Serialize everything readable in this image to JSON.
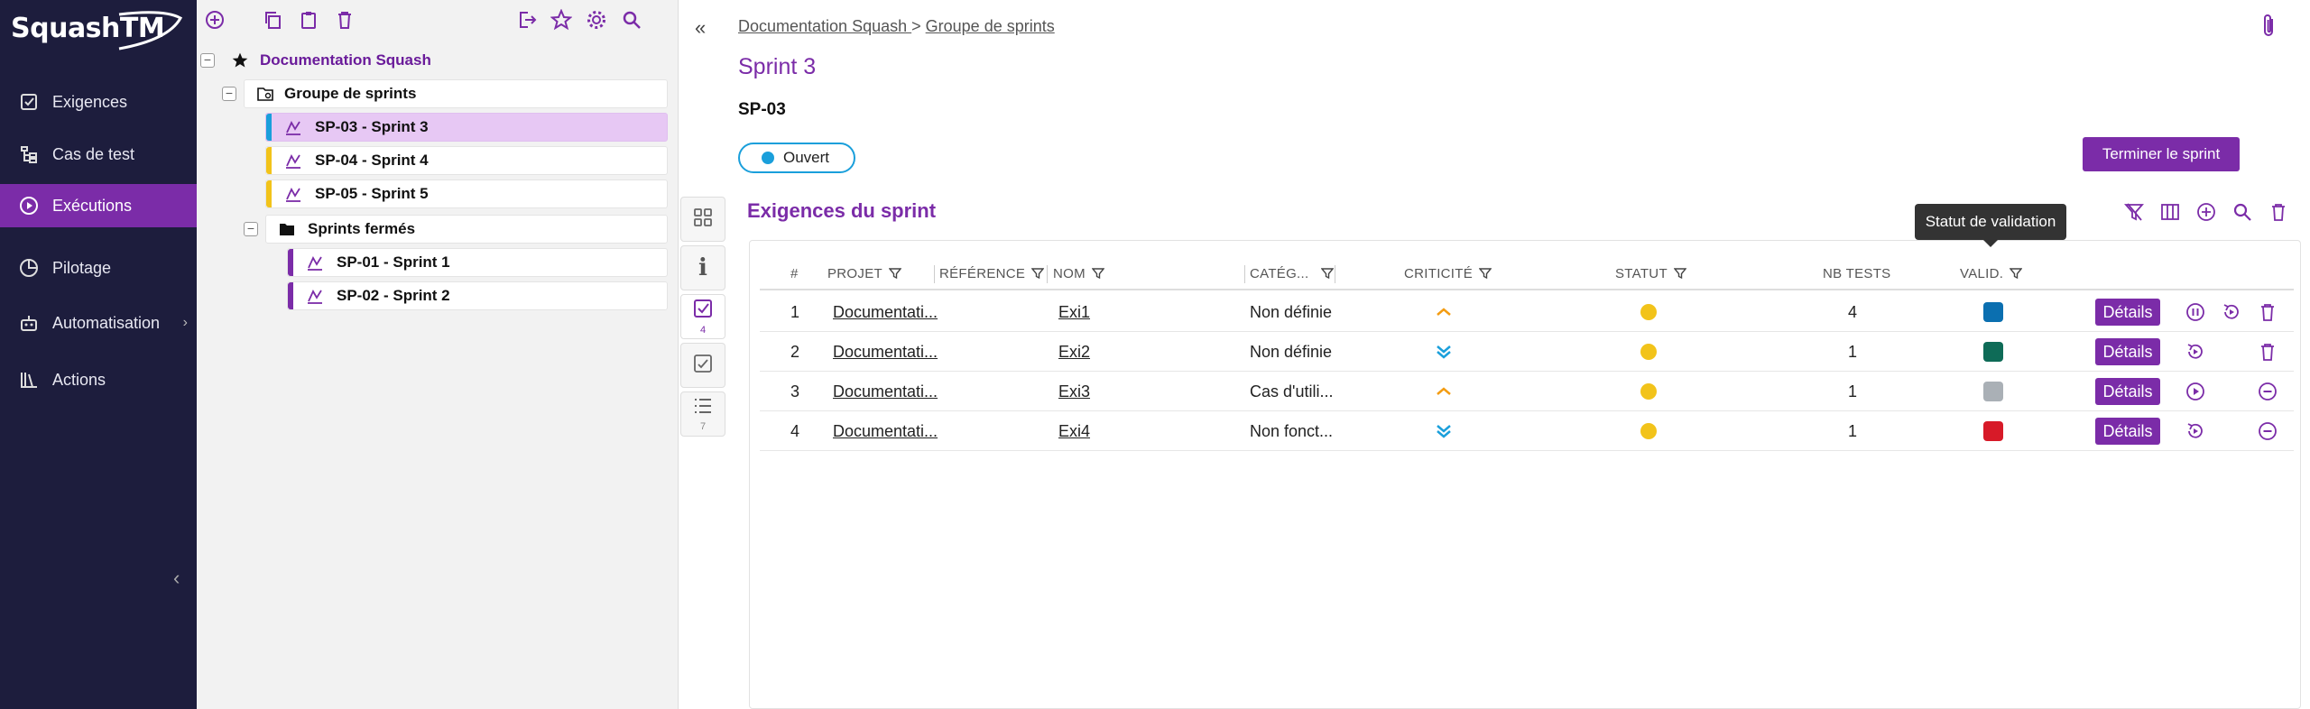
{
  "app": {
    "name": "SquashTM"
  },
  "nav": {
    "items": [
      {
        "label": "Exigences",
        "icon": "checkbox-icon",
        "active": false
      },
      {
        "label": "Cas de test",
        "icon": "tree-icon",
        "active": false
      },
      {
        "label": "Exécutions",
        "icon": "play-circle-icon",
        "active": true
      },
      {
        "label": "Pilotage",
        "icon": "pie-chart-icon",
        "active": false
      },
      {
        "label": "Automatisation",
        "icon": "robot-icon",
        "active": false
      },
      {
        "label": "Actions",
        "icon": "library-icon",
        "active": false
      }
    ],
    "collapse_glyph": "‹"
  },
  "tree": {
    "root": "Documentation Squash",
    "folder": "Groupe de sprints",
    "sprints": [
      {
        "label": "SP-03 - Sprint 3",
        "color": "#1a9fdb",
        "selected": true
      },
      {
        "label": "SP-04 - Sprint 4",
        "color": "#f2c31a",
        "selected": false
      },
      {
        "label": "SP-05 - Sprint 5",
        "color": "#f2c31a",
        "selected": false
      }
    ],
    "closed_folder": "Sprints fermés",
    "closed_sprints": [
      {
        "label": "SP-01 - Sprint 1",
        "color": "#7b2ca8"
      },
      {
        "label": "SP-02 - Sprint 2",
        "color": "#7b2ca8"
      }
    ]
  },
  "side_tabs": [
    {
      "icon": "dashboard-icon",
      "count": ""
    },
    {
      "icon": "info-icon",
      "count": ""
    },
    {
      "icon": "requirement-icon",
      "count": "4"
    },
    {
      "icon": "checklist-icon",
      "count": ""
    },
    {
      "icon": "list-icon",
      "count": "7"
    }
  ],
  "breadcrumb": {
    "part1": "Documentation Squash ",
    "sep": ">",
    "part2": "Groupe de sprints"
  },
  "header": {
    "title": "Sprint 3",
    "reference": "SP-03",
    "status": "Ouvert",
    "action_button": "Terminer le sprint"
  },
  "section": {
    "title": "Exigences du sprint",
    "tooltip": "Statut de validation"
  },
  "table": {
    "headers": {
      "num": "#",
      "project": "PROJET",
      "reference": "RÉFÉRENCE",
      "name": "NOM",
      "category": "CATÉG...",
      "criticality": "CRITICITÉ",
      "status": "STATUT",
      "nb_tests": "NB TESTS",
      "validation": "VALID."
    },
    "rows": [
      {
        "num": "1",
        "project": "Documentati...",
        "name": "Exi1",
        "category": "Non définie",
        "criticality": "major",
        "nb_tests": "4",
        "validation_color": "#0b6fb0",
        "details": "Détails",
        "actions": [
          "pause",
          "restart",
          "delete"
        ]
      },
      {
        "num": "2",
        "project": "Documentati...",
        "name": "Exi2",
        "category": "Non définie",
        "criticality": "minor",
        "nb_tests": "1",
        "validation_color": "#0e6b57",
        "details": "Détails",
        "actions": [
          "restart",
          "delete"
        ]
      },
      {
        "num": "3",
        "project": "Documentati...",
        "name": "Exi3",
        "category": "Cas d'utili...",
        "criticality": "major",
        "nb_tests": "1",
        "validation_color": "#aab0b6",
        "details": "Détails",
        "actions": [
          "play",
          "remove"
        ]
      },
      {
        "num": "4",
        "project": "Documentati...",
        "name": "Exi4",
        "category": "Non fonct...",
        "criticality": "minor",
        "nb_tests": "1",
        "validation_color": "#d71a28",
        "details": "Détails",
        "actions": [
          "restart",
          "remove"
        ]
      }
    ]
  },
  "colors": {
    "accent": "#7b2ca8",
    "nav_bg": "#1d1d3d",
    "status_open": "#1a9fdb",
    "status_yellow": "#f2c31a"
  }
}
